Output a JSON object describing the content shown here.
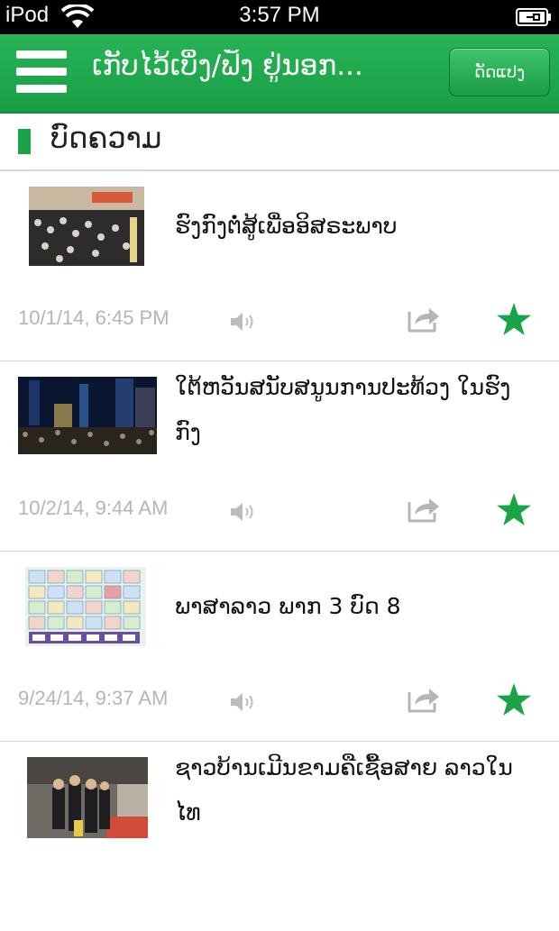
{
  "status_bar": {
    "carrier": "iPod",
    "time": "3:57 PM"
  },
  "nav": {
    "title": "ເກັບໄວ້ເບິ່ງ/ຟັງ ຢູ່ນອກ...",
    "edit_label": "ດັດແປງ"
  },
  "section": {
    "title": "ບົດຄວາມ"
  },
  "articles": [
    {
      "title": "ຮົງກົງຕໍ່ສູ້ເພື່ອອິສຣະພາບ",
      "date": "10/1/14, 6:45 PM",
      "thumbnail": "crowd-protest-photo"
    },
    {
      "title": "ໃຕ້ຫວັນສນັບສນູນການປະທ້ວງ ໃນຮົງກົງ",
      "date": "10/2/14, 9:44 AM",
      "thumbnail": "night-city-crowd-photo"
    },
    {
      "title": "ພາສາລາວ ພາກ 3 ບົດ 8",
      "date": "9/24/14, 9:37 AM",
      "thumbnail": "lao-alphabet-chart"
    },
    {
      "title": "ຊາວບ້ານເມີນຂາມຄືເຊື້ອສາຍ ລາວໃນໄທ",
      "date": "",
      "thumbnail": "villagers-photo"
    }
  ],
  "colors": {
    "accent": "#1aa448",
    "star": "#1aa448",
    "date": "#b5b5b5"
  }
}
